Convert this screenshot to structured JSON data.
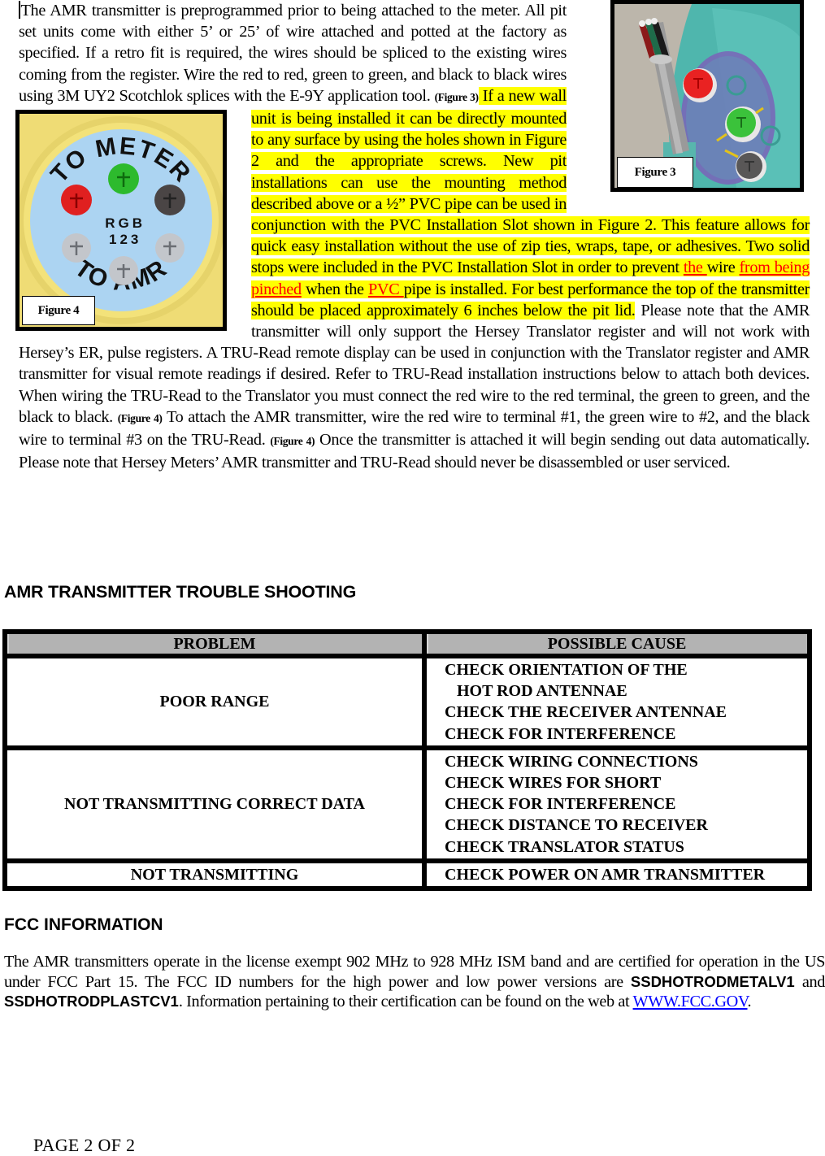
{
  "intro": {
    "p1": "The AMR transmitter is preprogrammed prior to being attached to the meter.  All pit set units come with either 5’ or 25’ of wire attached and potted at the factory as specified.  If a retro fit is required, the wires should be spliced to the existing wires coming from the register.  Wire the red to red, green to green, and black to black wires using 3M UY2 Scotchlok splices with the E-9Y application tool.",
    "fig3_ref": "(Figure 3)",
    "hl1": " If a new wall unit is being installed it can be directly mounted to any surface by using the holes shown in Figure 2 and the appropriate screws.  New pit installations can use the mounting method described above or a ½” PVC pipe can be used in conjunction with the PVC Installation Slot shown in Figure 2. This feature allows for quick easy installation without the use of zip ties, wraps, tape, or adhesives.  Two solid stops were included in the PVC Installation Slot in order to prevent ",
    "red1": "the ",
    "hl2": "wire ",
    "red2": "from being pinched",
    "hl3": " when the ",
    "red3": "PVC ",
    "hl4": "pipe is installed. For best performance the top of the transmitter should be placed approximately 6 inches below the pit lid.",
    "p2": " Please note that the AMR transmitter will only support the Hersey Translator register and will not work with Hersey’s ER, pulse registers.  A TRU-Read remote display can be used in conjunction with the Translator register and AMR transmitter for visual remote readings if desired.  Refer to TRU-Read installation instructions below to attach both devices. When wiring the TRU-Read to the Translator you must connect the red wire to the red terminal, the green to green, and the black to black.  ",
    "fig4_ref_a": "(Figure 4)",
    "p3": " To attach the AMR transmitter, wire the red wire to terminal #1, the green wire to #2, and the black wire to terminal #3 on the TRU-Read. ",
    "fig4_ref_b": "(Figure 4)",
    "p4": "  Once the transmitter is attached it will begin sending out data automatically.  Please note that Hersey Meters’ AMR transmitter and TRU-Read should never be disassembled or user serviced."
  },
  "figures": {
    "fig3": {
      "label": "Figure 3",
      "description": "Transmitter cavity with red, green and black wire terminals"
    },
    "fig4": {
      "label": "Figure 4",
      "top_text": "TO METER",
      "bottom_text": "TO AMR",
      "letters": "R G B",
      "numbers": "1 2 3"
    }
  },
  "troubleshooting": {
    "heading": "AMR TRANSMITTER TROUBLE SHOOTING",
    "columns": [
      "PROBLEM",
      "POSSIBLE CAUSE"
    ],
    "rows": [
      {
        "problem": "POOR RANGE",
        "causes": [
          "CHECK ORIENTATION OF THE",
          "   HOT ROD ANTENNAE",
          "CHECK THE RECEIVER ANTENNAE",
          "CHECK FOR INTERFERENCE"
        ]
      },
      {
        "problem": "NOT TRANSMITTING CORRECT DATA",
        "causes": [
          "CHECK WIRING CONNECTIONS",
          "CHECK WIRES FOR SHORT",
          "CHECK FOR INTERFERENCE",
          "CHECK DISTANCE TO RECEIVER",
          "CHECK TRANSLATOR STATUS"
        ]
      },
      {
        "problem": "NOT TRANSMITTING",
        "causes": [
          "CHECK POWER ON AMR TRANSMITTER"
        ]
      }
    ]
  },
  "fcc": {
    "heading": "FCC INFORMATION",
    "text1": "The AMR transmitters operate in the license exempt 902 MHz to 928 MHz ISM band and are certified for operation in the US under FCC Part 15.  The FCC ID numbers for the high power and low power versions are ",
    "id1": "SSDHOTRODMETALV1",
    "and": " and ",
    "id2": "SSDHOTRODPLASTCV1",
    "text2": ".  Information pertaining to their certification can be found on the web at ",
    "link": "WWW.FCC.GOV",
    "text3": "."
  },
  "colors": {
    "highlight": "#ffff00",
    "revision_red": "#ff0000",
    "link_blue": "#0000ff",
    "table_header_gray": "#b3b3b3"
  },
  "footer": {
    "page": "PAGE 2 OF 2"
  }
}
